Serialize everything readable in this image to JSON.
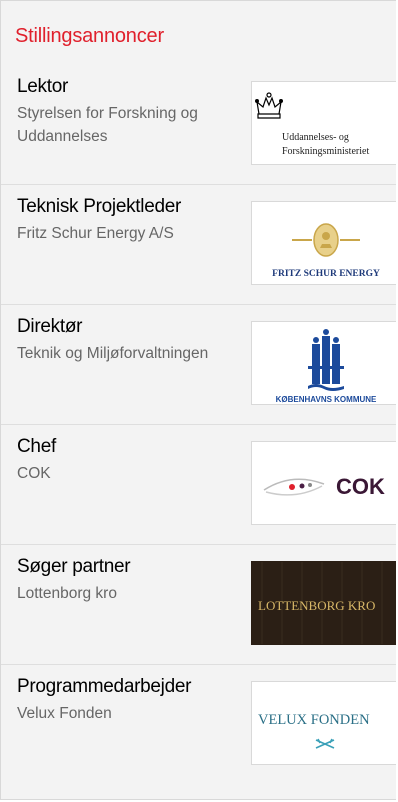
{
  "section": {
    "title": "Stillingsannoncer"
  },
  "jobs": [
    {
      "title": "Lektor",
      "company": "Styrelsen for Forskning og Uddannelses",
      "logo": {
        "name": "uddannelses-og-forskningsministeriet-logo",
        "line1": "Uddannelses- og",
        "line2": "Forskningsministeriet"
      }
    },
    {
      "title": "Teknisk Projektleder",
      "company": "Fritz Schur Energy A/S",
      "logo": {
        "name": "fritz-schur-energy-logo",
        "text": "FRITZ SCHUR ENERGY"
      }
    },
    {
      "title": "Direktør",
      "company": "Teknik og Miljøforvaltningen",
      "logo": {
        "name": "koebenhavns-kommune-logo",
        "text": "KØBENHAVNS KOMMUNE"
      }
    },
    {
      "title": "Chef",
      "company": "COK",
      "logo": {
        "name": "cok-logo",
        "text": "COK"
      }
    },
    {
      "title": "Søger partner",
      "company": "Lottenborg kro",
      "logo": {
        "name": "lottenborg-kro-logo",
        "text": "LOTTENBORG KRO"
      }
    },
    {
      "title": "Programmedarbejder",
      "company": "Velux Fonden",
      "logo": {
        "name": "velux-fonden-logo",
        "text": "VELUX FONDEN"
      }
    }
  ],
  "colors": {
    "accent": "#e0202c",
    "velux": "#2a6f86",
    "fritz": "#1e3a7a",
    "kk": "#1c4a9b"
  }
}
